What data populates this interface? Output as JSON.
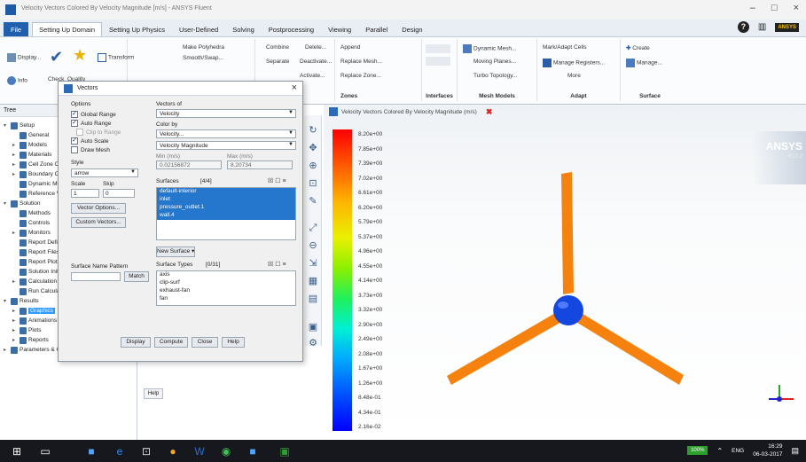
{
  "window": {
    "title": "Velocity Vectors Colored By Velocity Magnitude [m/s] - ANSYS Fluent"
  },
  "ribbon_tabs": [
    "File",
    "Setting Up Domain",
    "Setting Up Physics",
    "User-Defined",
    "Solving",
    "Postprocessing",
    "Viewing",
    "Parallel",
    "Design"
  ],
  "ribbon": {
    "groups": {
      "display": "Display...",
      "info": "Info",
      "check": "Check",
      "quality": "Quality",
      "transform": "Transform",
      "make_polyhedra": "Make Polyhedra",
      "smooth_swap": "Smooth/Swap...",
      "combine": "Combine",
      "delete": "Delete...",
      "separate": "Separate",
      "deactivate": "Deactivate...",
      "activate": "Activate...",
      "append": "Append",
      "replace_mesh": "Replace Mesh...",
      "replace_zone": "Replace Zone...",
      "zones_label": "Zones",
      "interfaces_label": "Interfaces",
      "dynamic_mesh": "Dynamic Mesh...",
      "moving_planes": "Moving Planes...",
      "turbo_topology": "Turbo Topology...",
      "mesh_models_label": "Mesh Models",
      "mark_adapt": "Mark/Adapt Cells",
      "manage_registers": "Manage Registers...",
      "more": "More",
      "adapt_label": "Adapt",
      "create": "Create",
      "manage": "Manage...",
      "surface_label": "Surface"
    }
  },
  "tree": {
    "header": "Tree",
    "items": [
      {
        "label": "Setup",
        "indent": 0,
        "expand": "v"
      },
      {
        "label": "General",
        "indent": 1,
        "expand": ""
      },
      {
        "label": "Models",
        "indent": 1,
        "expand": ">"
      },
      {
        "label": "Materials",
        "indent": 1,
        "expand": ">"
      },
      {
        "label": "Cell Zone Conditions",
        "indent": 1,
        "expand": ">"
      },
      {
        "label": "Boundary Conditions",
        "indent": 1,
        "expand": ">"
      },
      {
        "label": "Dynamic Mesh",
        "indent": 1,
        "expand": ""
      },
      {
        "label": "Reference Values",
        "indent": 1,
        "expand": ""
      },
      {
        "label": "Solution",
        "indent": 0,
        "expand": "v"
      },
      {
        "label": "Methods",
        "indent": 1,
        "expand": ""
      },
      {
        "label": "Controls",
        "indent": 1,
        "expand": ""
      },
      {
        "label": "Monitors",
        "indent": 1,
        "expand": ">"
      },
      {
        "label": "Report Definitions",
        "indent": 1,
        "expand": ""
      },
      {
        "label": "Report Files",
        "indent": 1,
        "expand": ""
      },
      {
        "label": "Report Plots",
        "indent": 1,
        "expand": ""
      },
      {
        "label": "Solution Initialization",
        "indent": 1,
        "expand": ""
      },
      {
        "label": "Calculation Activities",
        "indent": 1,
        "expand": ">"
      },
      {
        "label": "Run Calculation",
        "indent": 1,
        "expand": ""
      },
      {
        "label": "Results",
        "indent": 0,
        "expand": "v"
      },
      {
        "label": "Graphics",
        "indent": 1,
        "expand": ">",
        "selected": true
      },
      {
        "label": "Animations",
        "indent": 1,
        "expand": ">"
      },
      {
        "label": "Plots",
        "indent": 1,
        "expand": ">"
      },
      {
        "label": "Reports",
        "indent": 1,
        "expand": ">"
      },
      {
        "label": "Parameters & Customization",
        "indent": 0,
        "expand": ">"
      }
    ],
    "help_button": "Help"
  },
  "dialog": {
    "title": "Vectors",
    "options_label": "Options",
    "opt_global_range": "Global Range",
    "opt_auto_range": "Auto Range",
    "opt_clip_to_range": "Clip to Range",
    "opt_auto_scale": "Auto Scale",
    "opt_draw_mesh": "Draw Mesh",
    "style_label": "Style",
    "style_value": "arrow",
    "scale_label": "Scale",
    "skip_label": "Skip",
    "scale_value": "1",
    "skip_value": "0",
    "vector_options": "Vector Options...",
    "custom_vectors": "Custom Vectors...",
    "vectors_of_label": "Vectors of",
    "vectors_of_value": "Velocity",
    "color_by_label": "Color by",
    "color_by_value": "Velocity...",
    "color_by_sub": "Velocity Magnitude",
    "min_label": "Min (m/s)",
    "max_label": "Max (m/s)",
    "min_value": "0.02156872",
    "max_value": "8.20734",
    "surfaces_label": "Surfaces",
    "surfaces_count": "[4/4]",
    "surfaces": [
      "default-interior",
      "inlet",
      "pressure_outlet.1",
      "wall.4"
    ],
    "new_surface": "New Surface",
    "surface_name_pattern": "Surface Name Pattern",
    "match_button": "Match",
    "surface_types_label": "Surface Types",
    "surface_types_count": "[0/31]",
    "surface_types": [
      "axis",
      "clip-surf",
      "exhaust-fan",
      "fan"
    ],
    "buttons": {
      "display": "Display",
      "compute": "Compute",
      "close": "Close",
      "help": "Help"
    },
    "checks": {
      "global_range": true,
      "auto_range": true,
      "clip_to_range": false,
      "auto_scale": true,
      "draw_mesh": false
    }
  },
  "graphics": {
    "tab_title": "Velocity Vectors Colored By Velocity Magnitude (m/s)",
    "colorbar_labels": [
      "8.20e+00",
      "7.85e+00",
      "7.39e+00",
      "7.02e+00",
      "6.61e+00",
      "6.20e+00",
      "5.79e+00",
      "5.37e+00",
      "4.96e+00",
      "4.55e+00",
      "4.14e+00",
      "3.73e+00",
      "3.32e+00",
      "2.90e+00",
      "2.49e+00",
      "2.08e+00",
      "1.67e+00",
      "1.26e+00",
      "8.48e-01",
      "4.34e-01",
      "2.16e-02"
    ],
    "logo": "ANSYS",
    "logo_sub": "R17.2",
    "colors": {
      "blade": "#f5820f",
      "hub": "#1446e0"
    }
  },
  "taskbar": {
    "battery": "100%",
    "language": "ENG",
    "time": "16:29",
    "date": "06-03-2017"
  }
}
